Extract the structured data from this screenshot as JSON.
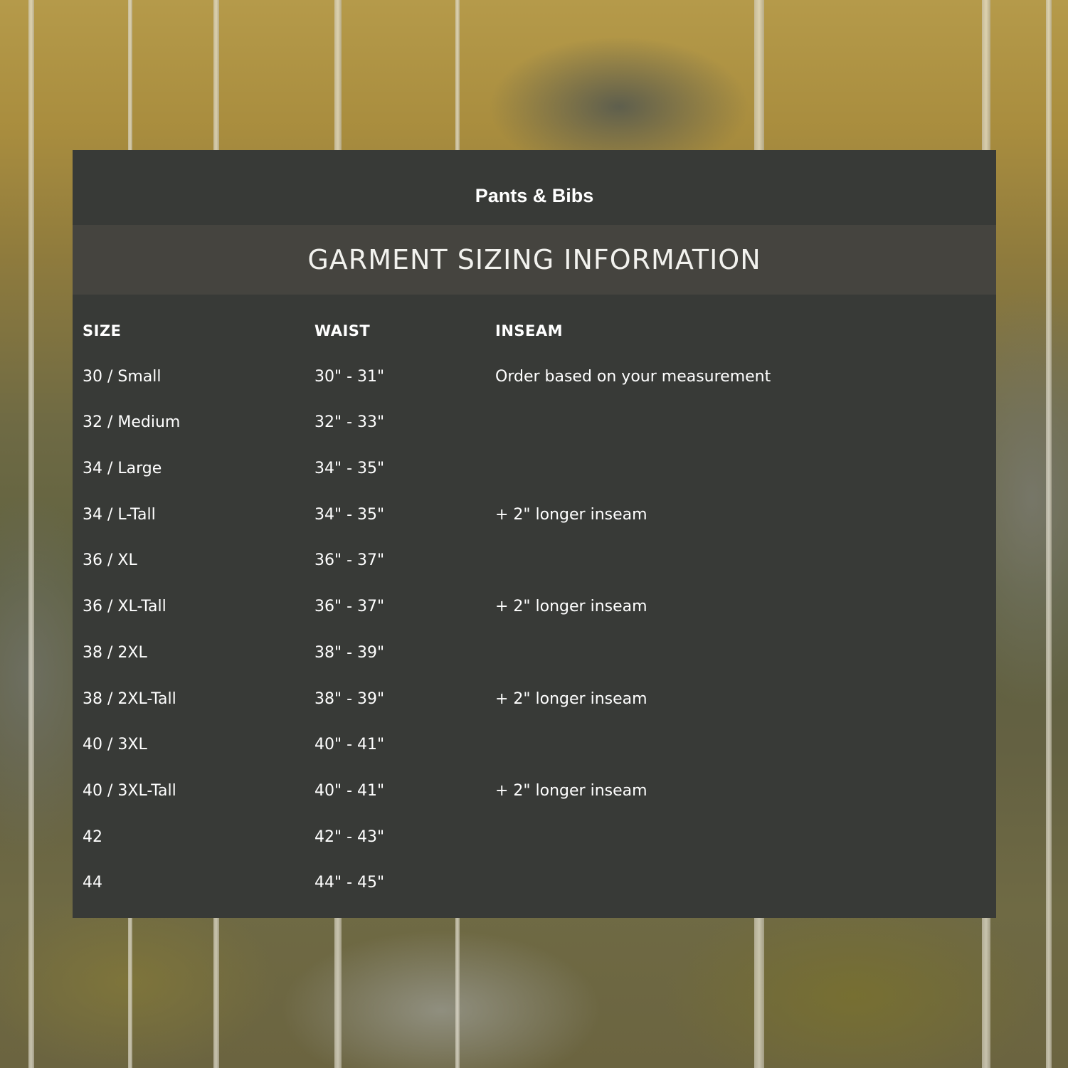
{
  "header": {
    "product_name": "Pants & Bibs"
  },
  "banner": {
    "title": "GARMENT SIZING INFORMATION"
  },
  "table": {
    "columns": [
      "SIZE",
      "WAIST",
      "INSEAM"
    ],
    "rows": [
      [
        "30 / Small",
        "30\" - 31\"",
        "Order based on your measurement"
      ],
      [
        "32 / Medium",
        "32\" - 33\"",
        ""
      ],
      [
        "34 / Large",
        "34\" - 35\"",
        ""
      ],
      [
        "34 / L-Tall",
        "34\" - 35\"",
        "+ 2\" longer inseam"
      ],
      [
        "36 / XL",
        "36\" - 37\"",
        ""
      ],
      [
        "36 / XL-Tall",
        "36\" - 37\"",
        "+ 2\" longer inseam"
      ],
      [
        "38 / 2XL",
        "38\" - 39\"",
        ""
      ],
      [
        "38 / 2XL-Tall",
        "38\" - 39\"",
        "+ 2\" longer inseam"
      ],
      [
        "40 / 3XL",
        "40\" - 41\"",
        ""
      ],
      [
        "40 / 3XL-Tall",
        "40\" - 41\"",
        "+ 2\" longer inseam"
      ],
      [
        "42",
        "42\" - 43\"",
        ""
      ],
      [
        "44",
        "44\" - 45\"",
        ""
      ]
    ]
  },
  "colors": {
    "panel": "#383a37",
    "banner": "#45443f",
    "text": "#ffffff"
  }
}
